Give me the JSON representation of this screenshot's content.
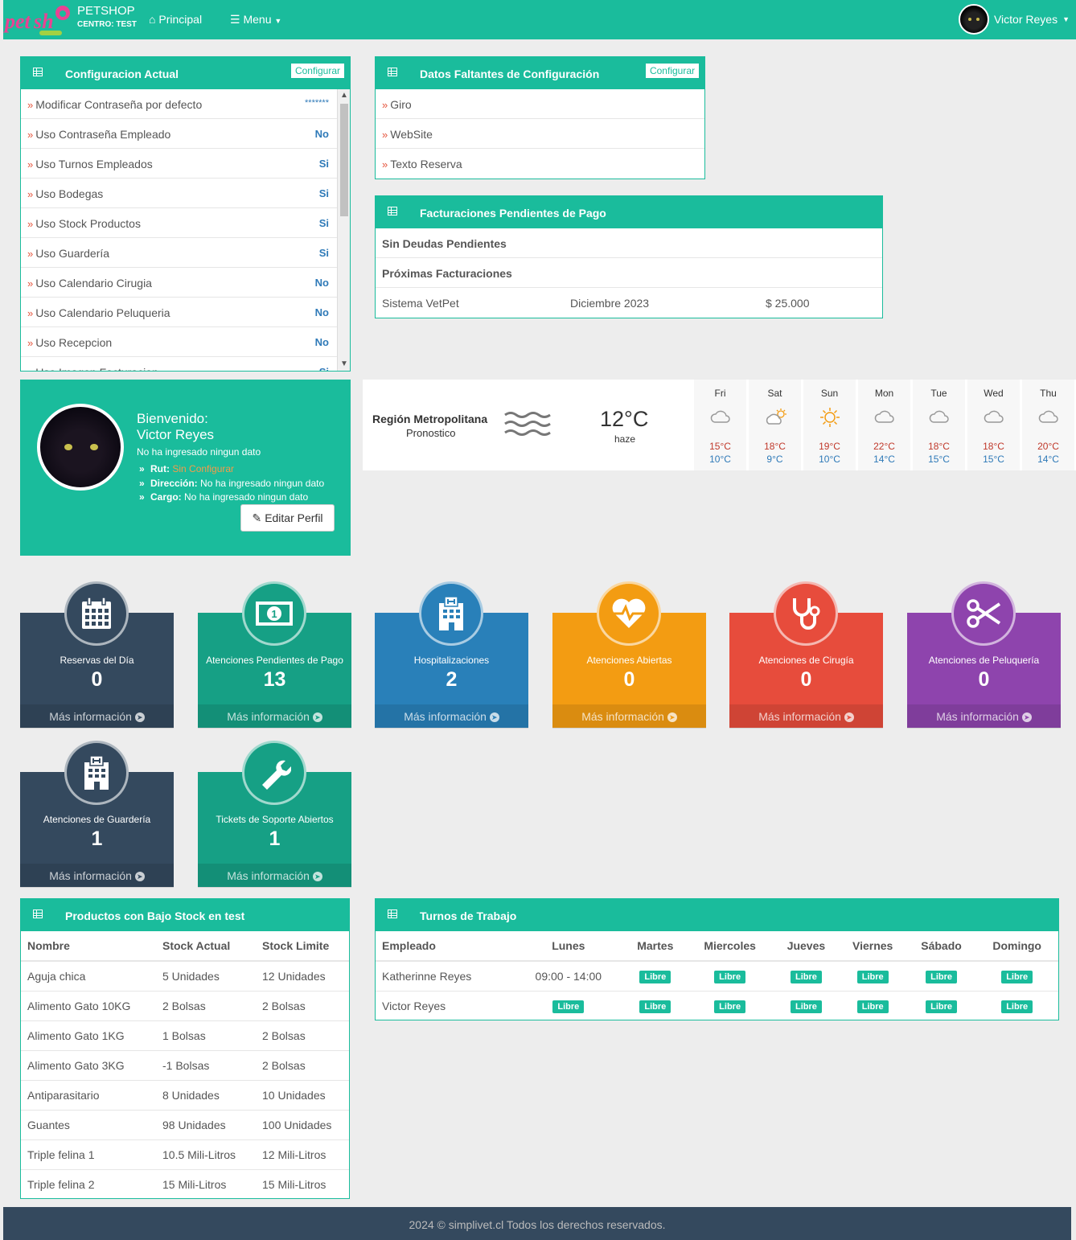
{
  "navbar": {
    "brand_title": "PETSHOP",
    "brand_center": "CENTRO: TEST",
    "home_label": "Principal",
    "menu_label": "Menu",
    "user_name": "Victor Reyes",
    "logo_text": "petshop"
  },
  "config_panel": {
    "title": "Configuracion Actual",
    "button": "Configurar",
    "items": [
      {
        "label": "Modificar Contraseña por defecto",
        "value": "*******"
      },
      {
        "label": "Uso Contraseña Empleado",
        "value": "No"
      },
      {
        "label": "Uso Turnos Empleados",
        "value": "Si"
      },
      {
        "label": "Uso Bodegas",
        "value": "Si"
      },
      {
        "label": "Uso Stock Productos",
        "value": "Si"
      },
      {
        "label": "Uso Guardería",
        "value": "Si"
      },
      {
        "label": "Uso Calendario Cirugia",
        "value": "No"
      },
      {
        "label": "Uso Calendario Peluqueria",
        "value": "No"
      },
      {
        "label": "Uso Recepcion",
        "value": "No"
      },
      {
        "label": "Uso Imagen Facturacion",
        "value": "Si"
      }
    ]
  },
  "missing_panel": {
    "title": "Datos Faltantes de Configuración",
    "button": "Configurar",
    "items": [
      "Giro",
      "WebSite",
      "Texto Reserva"
    ]
  },
  "billing_panel": {
    "title": "Facturaciones Pendientes de Pago",
    "no_debts": "Sin Deudas Pendientes",
    "next": "Próximas Facturaciones",
    "row": {
      "system": "Sistema VetPet",
      "month": "Diciembre 2023",
      "amount": "$ 25.000"
    }
  },
  "profile": {
    "welcome": "Bienvenido:",
    "name": "Victor Reyes",
    "no_data": "No ha ingresado ningun dato",
    "rut_label": "Rut:",
    "rut_value": "Sin Configurar",
    "address_label": "Dirección:",
    "address_value": "No ha ingresado ningun dato",
    "role_label": "Cargo:",
    "role_value": "No ha ingresado ningun dato",
    "edit_button": "Editar Perfil"
  },
  "weather": {
    "region": "Región Metropolitana",
    "subtitle": "Pronostico",
    "temp": "12°C",
    "condition": "haze",
    "days": [
      {
        "name": "Fri",
        "icon": "cloud-icon",
        "hi": "15°C",
        "lo": "10°C"
      },
      {
        "name": "Sat",
        "icon": "partly-sunny-icon",
        "hi": "18°C",
        "lo": "9°C"
      },
      {
        "name": "Sun",
        "icon": "sun-icon",
        "hi": "19°C",
        "lo": "10°C"
      },
      {
        "name": "Mon",
        "icon": "cloud-icon",
        "hi": "22°C",
        "lo": "14°C"
      },
      {
        "name": "Tue",
        "icon": "cloud-icon",
        "hi": "18°C",
        "lo": "15°C"
      },
      {
        "name": "Wed",
        "icon": "cloud-icon",
        "hi": "18°C",
        "lo": "15°C"
      },
      {
        "name": "Thu",
        "icon": "cloud-icon",
        "hi": "20°C",
        "lo": "14°C"
      }
    ]
  },
  "stats": [
    {
      "caption": "Reservas del Día",
      "value": "0",
      "more": "Más información",
      "icon": "calendar-icon",
      "color": "#34495e"
    },
    {
      "caption": "Atenciones Pendientes de Pago",
      "value": "13",
      "more": "Más información",
      "icon": "money-icon",
      "color": "#16a085"
    },
    {
      "caption": "Hospitalizaciones",
      "value": "2",
      "more": "Más información",
      "icon": "hospital-icon",
      "color": "#2980b9"
    },
    {
      "caption": "Atenciones Abiertas",
      "value": "0",
      "more": "Más información",
      "icon": "heartbeat-icon",
      "color": "#f39c12"
    },
    {
      "caption": "Atenciones de Cirugía",
      "value": "0",
      "more": "Más información",
      "icon": "stethoscope-icon",
      "color": "#e74c3c"
    },
    {
      "caption": "Atenciones de Peluquería",
      "value": "0",
      "more": "Más información",
      "icon": "scissors-icon",
      "color": "#8e44ad"
    },
    {
      "caption": "Atenciones de Guardería",
      "value": "1",
      "more": "Más información",
      "icon": "building-icon",
      "color": "#34495e"
    },
    {
      "caption": "Tickets de Soporte Abiertos",
      "value": "1",
      "more": "Más información",
      "icon": "wrench-icon",
      "color": "#16a085"
    }
  ],
  "stock_panel": {
    "title": "Productos con Bajo Stock en test",
    "headers": [
      "Nombre",
      "Stock Actual",
      "Stock Limite"
    ],
    "rows": [
      [
        "Aguja chica",
        "5 Unidades",
        "12 Unidades"
      ],
      [
        "Alimento Gato 10KG",
        "2 Bolsas",
        "2 Bolsas"
      ],
      [
        "Alimento Gato 1KG",
        "1 Bolsas",
        "2 Bolsas"
      ],
      [
        "Alimento Gato 3KG",
        "-1 Bolsas",
        "2 Bolsas"
      ],
      [
        "Antiparasitario",
        "8 Unidades",
        "10 Unidades"
      ],
      [
        "Guantes",
        "98 Unidades",
        "100 Unidades"
      ],
      [
        "Triple felina 1",
        "10.5 Mili-Litros",
        "12 Mili-Litros"
      ],
      [
        "Triple felina 2",
        "15 Mili-Litros",
        "15 Mili-Litros"
      ]
    ]
  },
  "shifts_panel": {
    "title": "Turnos de Trabajo",
    "headers": [
      "Empleado",
      "Lunes",
      "Martes",
      "Miercoles",
      "Jueves",
      "Viernes",
      "Sábado",
      "Domingo"
    ],
    "rows": [
      [
        "Katherinne Reyes",
        "09:00 - 14:00",
        "Libre",
        "Libre",
        "Libre",
        "Libre",
        "Libre",
        "Libre"
      ],
      [
        "Victor Reyes",
        "Libre",
        "Libre",
        "Libre",
        "Libre",
        "Libre",
        "Libre",
        "Libre"
      ]
    ]
  },
  "footer": "2024 © simplivet.cl Todos los derechos reservados."
}
